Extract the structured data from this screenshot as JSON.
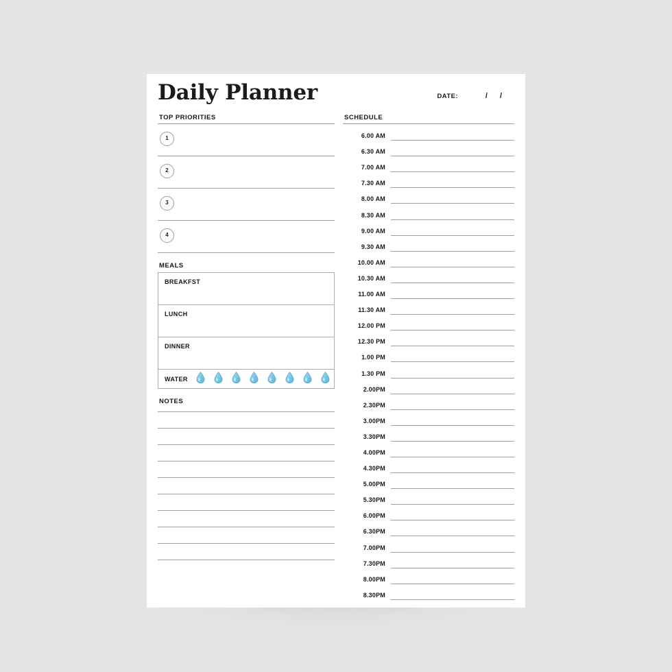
{
  "page": {
    "title": "Daily Planner",
    "background_color": "#e4e5e7",
    "paper_color": "#ffffff"
  },
  "header": {
    "title": "Daily Planner",
    "date_label": "DATE:",
    "date_separator_1": "/",
    "date_separator_2": "/"
  },
  "priorities": {
    "heading": "TOP PRIORITIES",
    "items": [
      {
        "number": "1"
      },
      {
        "number": "2"
      },
      {
        "number": "3"
      },
      {
        "number": "4"
      }
    ]
  },
  "meals": {
    "heading": "MEALS",
    "rows": [
      {
        "label": "BREAKFST"
      },
      {
        "label": "LUNCH"
      },
      {
        "label": "DINNER"
      }
    ],
    "water": {
      "label": "WATER",
      "droplet_count": 8,
      "droplet_color": "#7ec9e8",
      "droplet_outline": "#4a9fc4"
    }
  },
  "notes": {
    "heading": "NOTES",
    "line_count": 10
  },
  "schedule": {
    "heading": "SCHEDULE",
    "rows": [
      {
        "time": "6.00 AM"
      },
      {
        "time": "6.30 AM"
      },
      {
        "time": "7.00 AM"
      },
      {
        "time": "7.30 AM"
      },
      {
        "time": "8.00 AM"
      },
      {
        "time": "8.30 AM"
      },
      {
        "time": "9.00 AM"
      },
      {
        "time": "9.30 AM"
      },
      {
        "time": "10.00 AM"
      },
      {
        "time": "10.30 AM"
      },
      {
        "time": "11.00 AM"
      },
      {
        "time": "11.30 AM"
      },
      {
        "time": "12.00 PM"
      },
      {
        "time": "12.30 PM"
      },
      {
        "time": "1.00 PM"
      },
      {
        "time": "1.30 PM"
      },
      {
        "time": "2.00PM"
      },
      {
        "time": "2.30PM"
      },
      {
        "time": "3.00PM"
      },
      {
        "time": "3.30PM"
      },
      {
        "time": "4.00PM"
      },
      {
        "time": "4.30PM"
      },
      {
        "time": "5.00PM"
      },
      {
        "time": "5.30PM"
      },
      {
        "time": "6.00PM"
      },
      {
        "time": "6.30PM"
      },
      {
        "time": "7.00PM"
      },
      {
        "time": "7.30PM"
      },
      {
        "time": "8.00PM"
      },
      {
        "time": "8.30PM"
      }
    ]
  }
}
